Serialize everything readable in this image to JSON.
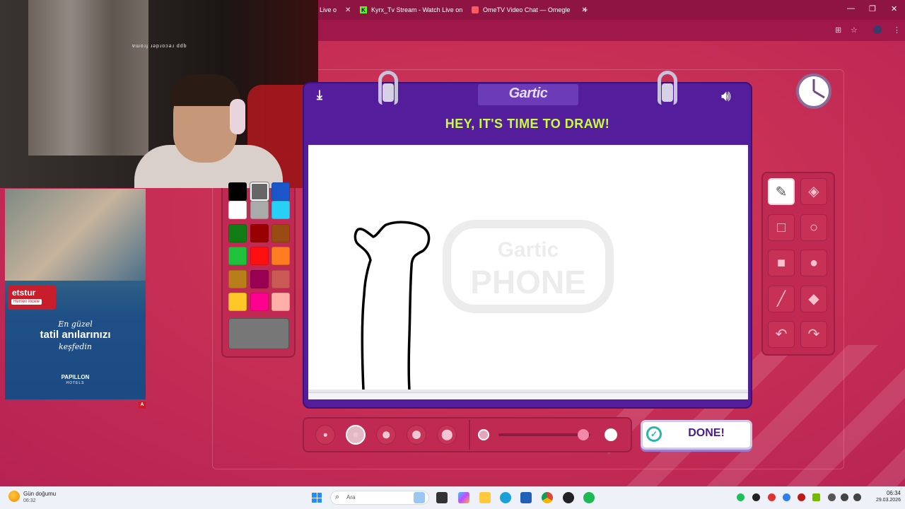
{
  "browser": {
    "tabs": [
      {
        "label": "Live o",
        "favicon": "generic-icon"
      },
      {
        "label": "Kyrx_Tv Stream - Watch Live on",
        "favicon": "kick-icon"
      },
      {
        "label": "OmeTV Video Chat — Omegle",
        "favicon": "ometv-icon"
      }
    ],
    "new_tab": "+",
    "window_controls": {
      "minimize": "—",
      "maximize": "❐",
      "close": "✕"
    }
  },
  "stream_overlay": {
    "mirror_text": "ɐɯoɹɟ ɹǝpɹoɔǝɹ ddb"
  },
  "ad": {
    "brand": "etstur",
    "cta": "Hemen İncele",
    "line1": "En güzel",
    "line2": "tatil anılarınızı",
    "line3": "keşfedin",
    "advertiser": "PAPILLON",
    "advertiser_sub": "HOTELS",
    "choice_badge": "A"
  },
  "game": {
    "logo": "Gartic",
    "title": "HEY, IT'S TIME TO DRAW!",
    "watermark_top": "Gartic",
    "watermark_bottom": "PHONE",
    "done_label": "DONE!",
    "colors": {
      "accent": "#c7ff3c",
      "board": "#541d9c",
      "page": "#c72f55"
    }
  },
  "palette": {
    "swatches": [
      [
        "#000000",
        "#666666",
        "#1b57c9"
      ],
      [
        "#ffffff",
        "#aaaaaa",
        "#29d0f5"
      ],
      [
        "#117c13",
        "#990000",
        "#994b12"
      ],
      [
        "#1fc23a",
        "#ff1010",
        "#ff7c20"
      ],
      [
        "#b77e19",
        "#990054",
        "#cb5a57"
      ],
      [
        "#ffc826",
        "#ff008f",
        "#feafa8"
      ]
    ],
    "selected": "#666666",
    "current": "#777777"
  },
  "tools": [
    {
      "name": "pencil-tool",
      "glyph": "✎",
      "selected": true
    },
    {
      "name": "eraser-tool",
      "glyph": "◈",
      "selected": false
    },
    {
      "name": "rectangle-tool",
      "glyph": "□",
      "selected": false
    },
    {
      "name": "ellipse-tool",
      "glyph": "○",
      "selected": false
    },
    {
      "name": "filled-rectangle-tool",
      "glyph": "■",
      "selected": false
    },
    {
      "name": "filled-ellipse-tool",
      "glyph": "●",
      "selected": false
    },
    {
      "name": "line-tool",
      "glyph": "╱",
      "selected": false
    },
    {
      "name": "fill-tool",
      "glyph": "◆",
      "selected": false
    },
    {
      "name": "undo-tool",
      "glyph": "↶",
      "selected": false
    },
    {
      "name": "redo-tool",
      "glyph": "↷",
      "selected": false
    }
  ],
  "brush": {
    "sizes": [
      1,
      2,
      3,
      4,
      5
    ],
    "selected_size": 2,
    "opacity": 0.92
  },
  "taskbar": {
    "weather_title": "Gün doğumu",
    "weather_sub": "06:32",
    "search_placeholder": "Ara",
    "time": "06:34",
    "date": "29.03.2026"
  }
}
